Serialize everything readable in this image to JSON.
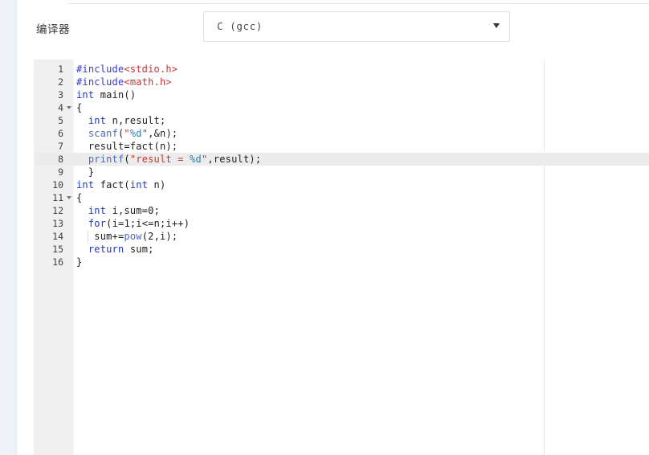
{
  "page": {
    "title": "Online Compiler Code Editor"
  },
  "header": {
    "compiler_label": "编译器",
    "compiler_selected": "C (gcc)",
    "caret_icon": "chevron-down-icon",
    "options": [
      "C (gcc)"
    ]
  },
  "editor": {
    "language": "c",
    "active_line": 8,
    "total_lines": 16,
    "fold_lines": [
      4,
      11
    ],
    "ruler_column": 80,
    "line_numbers": [
      "1",
      "2",
      "3",
      "4",
      "5",
      "6",
      "7",
      "8",
      "9",
      "10",
      "11",
      "12",
      "13",
      "14",
      "15",
      "16"
    ],
    "lines": [
      {
        "n": "1",
        "text": "#include<stdio.h>"
      },
      {
        "n": "2",
        "text": "#include<math.h>"
      },
      {
        "n": "3",
        "text": "int main()"
      },
      {
        "n": "4",
        "text": "{"
      },
      {
        "n": "5",
        "text": "  int n,result;"
      },
      {
        "n": "6",
        "text": "  scanf(\"%d\",&n);"
      },
      {
        "n": "7",
        "text": "  result=fact(n);"
      },
      {
        "n": "8",
        "text": "  printf(\"result = %d\",result);"
      },
      {
        "n": "9",
        "text": "  }"
      },
      {
        "n": "10",
        "text": "int fact(int n)"
      },
      {
        "n": "11",
        "text": "{"
      },
      {
        "n": "12",
        "text": "  int i,sum=0;"
      },
      {
        "n": "13",
        "text": "  for(i=1;i<=n;i++)"
      },
      {
        "n": "14",
        "text": "   sum+=pow(2,i);"
      },
      {
        "n": "15",
        "text": "  return sum;"
      },
      {
        "n": "16",
        "text": "}"
      }
    ],
    "full_source": "#include<stdio.h>\n#include<math.h>\nint main()\n{\n  int n,result;\n  scanf(\"%d\",&n);\n  result=fact(n);\n  printf(\"result = %d\",result);\n  }\nint fact(int n)\n{\n  int i,sum=0;\n  for(i=1;i<=n;i++)\n   sum+=pow(2,i);\n  return sum;\n}"
  },
  "colors": {
    "rail": "#eef2f6",
    "gutter": "#f0f0f0",
    "active_line": "#ececec",
    "keyword": "#1d39c4",
    "string": "#c0392b",
    "include": "#c8333b",
    "function": "#4c68b8",
    "format_spec": "#2f7fa8",
    "text": "#1d1d1d"
  }
}
